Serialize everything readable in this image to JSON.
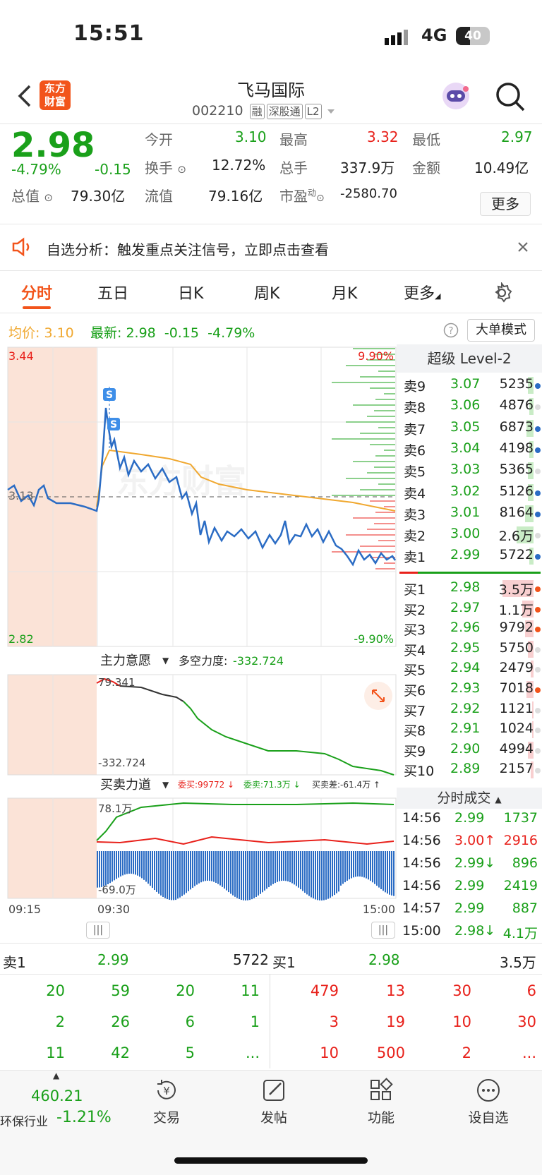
{
  "status_bar": {
    "time": "15:51",
    "network": "4G",
    "battery": "40"
  },
  "header": {
    "brand_line1": "东方",
    "brand_line2": "财富",
    "name": "飞马国际",
    "code": "002210",
    "tags": [
      "融",
      "深股通",
      "L2"
    ]
  },
  "quote": {
    "price": "2.98",
    "pct": "-4.79%",
    "chg": "-0.15",
    "open_label": "今开",
    "open": "3.10",
    "high_label": "最高",
    "high": "3.32",
    "low_label": "最低",
    "low": "2.97",
    "turnover_label": "换手",
    "turnover": "12.72%",
    "vol_label": "总手",
    "vol": "337.9万",
    "amount_label": "金额",
    "amount": "10.49亿",
    "mktcap_label": "总值",
    "mktcap": "79.30亿",
    "float_label": "流值",
    "float": "79.16亿",
    "pe_label": "市盈",
    "pe_sup": "动",
    "pe": "-2580.70",
    "more": "更多"
  },
  "alert": {
    "text": "自选分析：触发重点关注信号，立即点击查看"
  },
  "tabs": [
    "分时",
    "五日",
    "日K",
    "周K",
    "月K",
    "更多"
  ],
  "avg_line": {
    "avg_label": "均价:",
    "avg": "3.10",
    "last_label": "最新:",
    "last": "2.98",
    "chg": "-0.15",
    "pct": "-4.79%",
    "big_mode": "大单模式"
  },
  "chart": {
    "y_top": "3.44",
    "y_mid": "3.13",
    "y_bot": "2.82",
    "pct_top": "9.90%",
    "pct_bot": "-9.90%",
    "watermark": "东方财富",
    "s_marker": "S",
    "t_start": "09:15",
    "t_open": "09:30",
    "t_end": "15:00",
    "ind1_name": "主力意愿",
    "ind1_metric_label": "多空力度:",
    "ind1_metric": "-332.724",
    "ind1_hi": "79.341",
    "ind1_lo": "-332.724",
    "ind2_name": "买卖力道",
    "ind2_buy": "委买:99772 ↓",
    "ind2_sell": "委卖:71.3万 ↓",
    "ind2_diff": "买卖差:-61.4万 ↑",
    "ind2_hi": "78.1万",
    "ind2_lo": "-69.0万"
  },
  "level2": {
    "title": "超级 Level-2",
    "asks": [
      {
        "l": "卖9",
        "p": "3.07",
        "v": "5235"
      },
      {
        "l": "卖8",
        "p": "3.06",
        "v": "4876"
      },
      {
        "l": "卖7",
        "p": "3.05",
        "v": "6873"
      },
      {
        "l": "卖6",
        "p": "3.04",
        "v": "4198"
      },
      {
        "l": "卖5",
        "p": "3.03",
        "v": "5365"
      },
      {
        "l": "卖4",
        "p": "3.02",
        "v": "5126"
      },
      {
        "l": "卖3",
        "p": "3.01",
        "v": "8164"
      },
      {
        "l": "卖2",
        "p": "3.00",
        "v": "2.6万"
      },
      {
        "l": "卖1",
        "p": "2.99",
        "v": "5722"
      }
    ],
    "bids": [
      {
        "l": "买1",
        "p": "2.98",
        "v": "3.5万"
      },
      {
        "l": "买2",
        "p": "2.97",
        "v": "1.1万"
      },
      {
        "l": "买3",
        "p": "2.96",
        "v": "9792"
      },
      {
        "l": "买4",
        "p": "2.95",
        "v": "5750"
      },
      {
        "l": "买5",
        "p": "2.94",
        "v": "2479"
      },
      {
        "l": "买6",
        "p": "2.93",
        "v": "7018"
      },
      {
        "l": "买7",
        "p": "2.92",
        "v": "1121"
      },
      {
        "l": "买8",
        "p": "2.91",
        "v": "1024"
      },
      {
        "l": "买9",
        "p": "2.90",
        "v": "4994"
      },
      {
        "l": "买10",
        "p": "2.89",
        "v": "2157"
      }
    ],
    "trades_title": "分时成交",
    "trades": [
      {
        "t": "14:56",
        "p": "2.99",
        "v": "1737",
        "a": ""
      },
      {
        "t": "14:56",
        "p": "3.00↑",
        "v": "2916",
        "a": "up"
      },
      {
        "t": "14:56",
        "p": "2.99↓",
        "v": "896",
        "a": "down"
      },
      {
        "t": "14:56",
        "p": "2.99",
        "v": "2419",
        "a": ""
      },
      {
        "t": "14:57",
        "p": "2.99",
        "v": "887",
        "a": ""
      },
      {
        "t": "15:00",
        "p": "2.98↓",
        "v": "4.1万",
        "a": "down"
      }
    ]
  },
  "queue": {
    "sell_label": "卖1",
    "sell_price": "2.99",
    "sell_vol": "5722",
    "buy_label": "买1",
    "buy_price": "2.98",
    "buy_vol": "3.5万",
    "sell_rows": [
      [
        "20",
        "59",
        "20",
        "11"
      ],
      [
        "2",
        "26",
        "6",
        "1"
      ],
      [
        "11",
        "42",
        "5",
        "..."
      ]
    ],
    "buy_rows": [
      [
        "479",
        "13",
        "30",
        "6"
      ],
      [
        "3",
        "19",
        "10",
        "30"
      ],
      [
        "10",
        "500",
        "2",
        "..."
      ]
    ]
  },
  "bottom_nav": {
    "index_value": "460.21",
    "index_name": "环保行业",
    "index_pct": "-1.21%",
    "items": [
      "交易",
      "发帖",
      "功能",
      "设自选"
    ]
  },
  "colors": {
    "up": "#e8211b",
    "down": "#1aa01a",
    "accent": "#f2541b",
    "price_line": "#2b6cc4",
    "avg_line": "#f0a830"
  }
}
